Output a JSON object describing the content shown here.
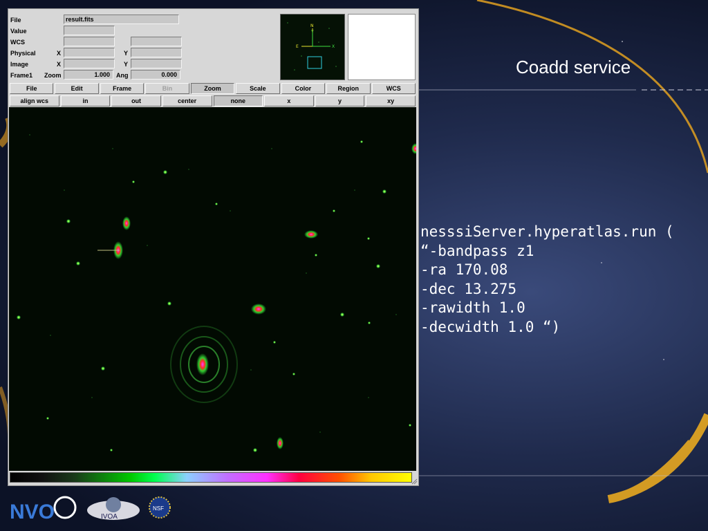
{
  "slide": {
    "title": "Coadd service",
    "code_lines": [
      "nesssiServer.hyperatlas.run (",
      "“-bandpass z1",
      "-ra 170.08",
      "-dec 13.275",
      "-rawidth 1.0",
      "-decwidth 1.0 “)"
    ]
  },
  "ds9": {
    "info": {
      "file_label": "File",
      "file_value": "result.fits",
      "value_label": "Value",
      "wcs_label": "WCS",
      "physical_label": "Physical",
      "image_label": "Image",
      "frame_label": "Frame1",
      "x_label": "X",
      "y_label": "Y",
      "zoom_label": "Zoom",
      "zoom_value": "1.000",
      "angle_label": "Ang",
      "angle_value": "0.000"
    },
    "panner": {
      "n_label": "N",
      "e_label": "E",
      "x_label": "X",
      "y_label": "Y"
    },
    "menu_buttons": [
      "File",
      "Edit",
      "Frame",
      "Bin",
      "Zoom",
      "Scale",
      "Color",
      "Region",
      "WCS"
    ],
    "zoom_buttons": [
      "align wcs",
      "in",
      "out",
      "center",
      "none",
      "x",
      "y",
      "xy"
    ]
  },
  "logos": {
    "nvo": "NVO",
    "ivoa": "IVOA",
    "nsf": "NSF"
  },
  "colors": {
    "accent_gold": "#e0a020",
    "slide_blue": "#1f2a4c"
  }
}
